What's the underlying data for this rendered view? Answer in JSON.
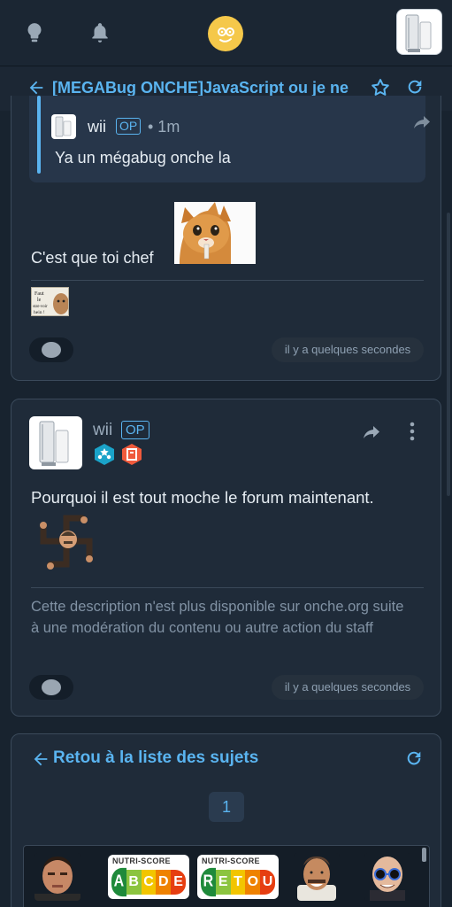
{
  "topbar": {
    "icons": [
      "lightbulb-icon",
      "bell-icon",
      "smiley-logo",
      "user-avatar"
    ]
  },
  "topic": {
    "title": "[MEGABug ONCHE]JavaScript ou je ne"
  },
  "post1": {
    "quote": {
      "author": "wii",
      "op_badge": "OP",
      "time": "• 1m",
      "text": "Ya un mégabug onche la"
    },
    "text": "C'est que toi chef",
    "signature_sticker_text": "Faut le stat-voir hein !",
    "timestamp": "il y a quelques secondes"
  },
  "post2": {
    "author": "wii",
    "op_badge": "OP",
    "text": "Pourquoi il est tout moche le forum maintenant.",
    "moderation_note": "Cette description n'est plus disponible sur onche.org suite à une modération du contenu ou autre action du staff",
    "timestamp": "il y a quelques secondes"
  },
  "footer_card": {
    "back_label": "Retou à la liste des sujets",
    "current_page": "1",
    "stickers": [
      {
        "type": "face",
        "name": "sticker-man-1"
      },
      {
        "type": "nutri",
        "label": "NUTRI-SCORE",
        "letters": [
          "A",
          "B",
          "C",
          "D",
          "E"
        ]
      },
      {
        "type": "nutri",
        "label": "NUTRI-SCORE",
        "letters": [
          "R",
          "E",
          "T",
          "O",
          "U"
        ]
      },
      {
        "type": "face",
        "name": "sticker-laughing-man"
      },
      {
        "type": "face",
        "name": "sticker-bald-man-glasses"
      }
    ]
  },
  "colors": {
    "accent": "#5ab4f0",
    "background": "#18232f",
    "card": "#1f2b39",
    "nutri": [
      "#1f8a3b",
      "#8bc43f",
      "#f2c500",
      "#ef8200",
      "#e63e11"
    ]
  }
}
